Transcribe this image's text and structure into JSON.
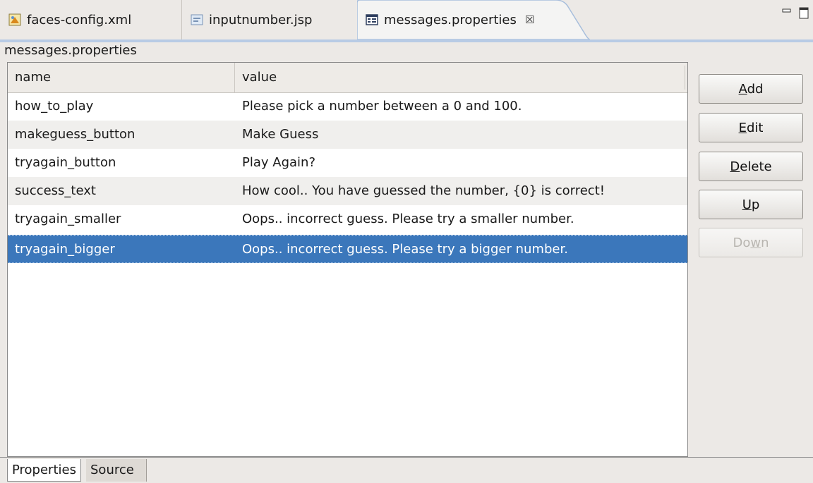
{
  "tabs": [
    {
      "label": "faces-config.xml",
      "icon": "faces-config-icon"
    },
    {
      "label": "inputnumber.jsp",
      "icon": "jsp-file-icon"
    },
    {
      "label": "messages.properties",
      "icon": "properties-file-icon",
      "close": "☒"
    }
  ],
  "editor_title": "messages.properties",
  "table": {
    "headers": [
      "name",
      "value"
    ],
    "rows": [
      {
        "name": "how_to_play",
        "value": "Please pick a number between a 0 and 100."
      },
      {
        "name": "makeguess_button",
        "value": "Make Guess"
      },
      {
        "name": "tryagain_button",
        "value": "Play Again?"
      },
      {
        "name": "success_text",
        "value": "How cool.. You have guessed the number, {0} is correct!"
      },
      {
        "name": "tryagain_smaller",
        "value": "Oops.. incorrect guess. Please try a smaller number."
      },
      {
        "name": "tryagain_bigger",
        "value": "Oops.. incorrect guess. Please try a bigger number.",
        "selected": true
      }
    ]
  },
  "buttons": {
    "add": "Add",
    "edit": "Edit",
    "delete": "Delete",
    "up": "Up",
    "down": "Down"
  },
  "bottom_tabs": [
    "Properties",
    "Source"
  ],
  "colors": {
    "selection": "#3b77bb",
    "active_tab_border": "#a7bedc",
    "background": "#ece9e6"
  }
}
